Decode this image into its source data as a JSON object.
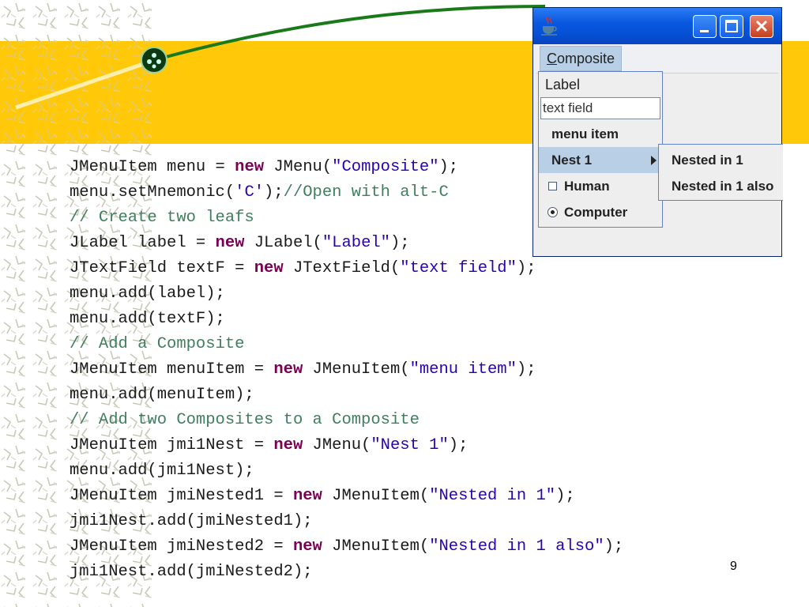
{
  "slide": {
    "page_number": "9",
    "banner_color": "#ffc90a"
  },
  "code_lines": [
    [
      {
        "t": "JMenuItem menu = ",
        "c": ""
      },
      {
        "t": "new",
        "c": "kw"
      },
      {
        "t": " JMenu(",
        "c": ""
      },
      {
        "t": "\"Composite\"",
        "c": "str"
      },
      {
        "t": ");",
        "c": ""
      }
    ],
    [
      {
        "t": "menu.setMnemonic(",
        "c": ""
      },
      {
        "t": "'C'",
        "c": "str"
      },
      {
        "t": ");",
        "c": ""
      },
      {
        "t": "//Open with alt-C",
        "c": "cm"
      }
    ],
    [
      {
        "t": "// Create two leafs",
        "c": "cm"
      }
    ],
    [
      {
        "t": "JLabel label = ",
        "c": ""
      },
      {
        "t": "new",
        "c": "kw"
      },
      {
        "t": " JLabel(",
        "c": ""
      },
      {
        "t": "\"Label\"",
        "c": "str"
      },
      {
        "t": ");",
        "c": ""
      }
    ],
    [
      {
        "t": "JTextField textF = ",
        "c": ""
      },
      {
        "t": "new",
        "c": "kw"
      },
      {
        "t": " JTextField(",
        "c": ""
      },
      {
        "t": "\"text field\"",
        "c": "str"
      },
      {
        "t": ");",
        "c": ""
      }
    ],
    [
      {
        "t": "menu.add(label);",
        "c": ""
      }
    ],
    [
      {
        "t": "menu.add(textF);",
        "c": ""
      }
    ],
    [
      {
        "t": "// Add a Composite",
        "c": "cm"
      }
    ],
    [
      {
        "t": "JMenuItem menuItem = ",
        "c": ""
      },
      {
        "t": "new",
        "c": "kw"
      },
      {
        "t": " JMenuItem(",
        "c": ""
      },
      {
        "t": "\"menu item\"",
        "c": "str"
      },
      {
        "t": ");",
        "c": ""
      }
    ],
    [
      {
        "t": "menu.add(menuItem);",
        "c": ""
      }
    ],
    [
      {
        "t": "// Add two Composites to a Composite",
        "c": "cm"
      }
    ],
    [
      {
        "t": "JMenuItem jmi1Nest = ",
        "c": ""
      },
      {
        "t": "new",
        "c": "kw"
      },
      {
        "t": " JMenu(",
        "c": ""
      },
      {
        "t": "\"Nest 1\"",
        "c": "str"
      },
      {
        "t": ");",
        "c": ""
      }
    ],
    [
      {
        "t": "menu.add(jmi1Nest);",
        "c": ""
      }
    ],
    [
      {
        "t": "JMenuItem jmiNested1 = ",
        "c": ""
      },
      {
        "t": "new",
        "c": "kw"
      },
      {
        "t": " JMenuItem(",
        "c": ""
      },
      {
        "t": "\"Nested in 1\"",
        "c": "str"
      },
      {
        "t": ");",
        "c": ""
      }
    ],
    [
      {
        "t": "jmi1Nest.add(jmiNested1);",
        "c": ""
      }
    ],
    [
      {
        "t": "JMenuItem jmiNested2 = ",
        "c": ""
      },
      {
        "t": "new",
        "c": "kw"
      },
      {
        "t": " JMenuItem(",
        "c": ""
      },
      {
        "t": "\"Nested in 1 also\"",
        "c": "str"
      },
      {
        "t": ");",
        "c": ""
      }
    ],
    [
      {
        "t": "jmi1Nest.add(jmiNested2);",
        "c": ""
      }
    ]
  ],
  "window": {
    "icon": "java-cup-icon",
    "menubar": {
      "menu_mnemonic": "C",
      "menu_rest": "omposite"
    },
    "popup": {
      "label": "Label",
      "text_field_value": "text field",
      "menu_item": "menu item",
      "nest": "Nest 1",
      "human": "Human",
      "human_checked": false,
      "computer": "Computer",
      "computer_selected": true
    },
    "submenu": {
      "items": [
        "Nested in 1",
        "Nested in 1 also"
      ]
    }
  }
}
